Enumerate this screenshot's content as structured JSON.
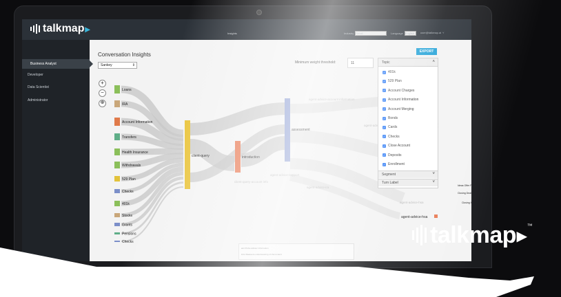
{
  "brand": {
    "name": "talkmap",
    "trademark": "™"
  },
  "topbar": {
    "center_label": "Insights",
    "fields": [
      {
        "label": "Industry",
        "value": "Retail"
      },
      {
        "label": "Language",
        "value": "English"
      },
      {
        "label": "user@talkmap.ai",
        "value": ""
      }
    ]
  },
  "sidebar": {
    "items": [
      {
        "label": "Business Analyst",
        "active": true
      },
      {
        "label": "Developer",
        "active": false
      },
      {
        "label": "Data Scientist",
        "active": false
      },
      {
        "label": "Administrator",
        "active": false
      }
    ]
  },
  "main": {
    "title": "Conversation Insights",
    "chart_select": "Sankey",
    "export_label": "EXPORT",
    "threshold_label": "Minimum weight threshold:",
    "threshold_value": "11"
  },
  "zoom": {
    "zoom_in": "+",
    "zoom_out": "−",
    "reset": "⊕"
  },
  "chart_data": {
    "type": "sankey",
    "sources": [
      {
        "label": "Loans",
        "color": "#8bbf5a"
      },
      {
        "label": "IRA",
        "color": "#c9a77a"
      },
      {
        "label": "Account Information",
        "color": "#e07a4a"
      },
      {
        "label": "Transfers",
        "color": "#5fae88"
      },
      {
        "label": "Health Insurance",
        "color": "#8bbf5a"
      },
      {
        "label": "Withdrawals",
        "color": "#8bbf5a"
      },
      {
        "label": "529 Plan",
        "color": "#e2c23b"
      },
      {
        "label": "Checks",
        "color": "#7c8fc9"
      },
      {
        "label": "401k",
        "color": "#8bbf5a"
      },
      {
        "label": "Stocks",
        "color": "#c9a77a"
      },
      {
        "label": "Grants",
        "color": "#7c8fc9"
      },
      {
        "label": "Pensions",
        "color": "#5fae88"
      },
      {
        "label": "Checks",
        "color": "#7c8fc9"
      }
    ],
    "stages": [
      {
        "label": "client-query",
        "color": "#e9c233"
      },
      {
        "label": "introduction",
        "color": "#e97b55"
      },
      {
        "label": "assessment",
        "color": "#8d9ed3"
      }
    ],
    "faded_labels": [
      "agent-advice-account information",
      "agent-advice-fin",
      "agent-advice-support",
      "agent-advice-ira",
      "client-query-account info",
      "agent-advice-hsa"
    ],
    "right_labels": [
      {
        "label": "agent-advice-hsa",
        "color": "#e97b55"
      },
      {
        "label": "Ideas Offer Pro...",
        "color": "#8d9ed3"
      },
      {
        "label": "Closing Deal X",
        "color": "#e97b55"
      },
      {
        "label": "Closing X",
        "color": "#e9c233"
      }
    ]
  },
  "topic_panel": {
    "title": "Topic",
    "items": [
      "401k",
      "529 Plan",
      "Account Charges",
      "Account Information",
      "Account Merging",
      "Bonds",
      "Cards",
      "Checks",
      "Close Account",
      "Deposits",
      "Enrollment"
    ],
    "sections": [
      "Segment",
      "Turn Label"
    ]
  },
  "bottom_table": {
    "rows": [
      "acc   Probe advisor information",
      "intro   Reassure understanding of client intent"
    ]
  }
}
